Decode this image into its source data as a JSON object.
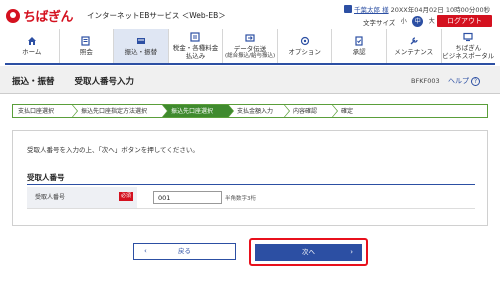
{
  "header": {
    "logo_text": "ちばぎん",
    "service_name": "インターネットEBサービス ＜Web-EB＞",
    "user_name": "千葉太郎 様",
    "login_time": "20XX年04月02日 10時00分00秒",
    "font_size_label": "文字サイズ",
    "font_sizes": [
      "小",
      "中",
      "大"
    ],
    "logout_label": "ログアウト"
  },
  "nav": {
    "items": [
      {
        "label": "ホーム",
        "icon": "home-icon"
      },
      {
        "label": "照会",
        "icon": "inquiry-icon"
      },
      {
        "label": "振込・振替",
        "icon": "transfer-icon"
      },
      {
        "label1": "税金・各種料金",
        "label2": "払込み",
        "icon": "tax-payment-icon"
      },
      {
        "label1": "データ伝送",
        "label2": "(総合振込/給与振込)",
        "icon": "data-transmission-icon"
      },
      {
        "label": "オプション",
        "icon": "option-icon"
      },
      {
        "label": "承認",
        "icon": "approval-icon"
      },
      {
        "label": "メンテナンス",
        "icon": "maintenance-icon"
      },
      {
        "label1": "ちばぎん",
        "label2": "ビジネスポータル",
        "icon": "portal-icon"
      }
    ]
  },
  "title_bar": {
    "category": "振込・振替",
    "title": "受取人番号入力",
    "screen_id": "BFKF003",
    "help_label": "ヘルプ"
  },
  "steps": [
    "支払口座選択",
    "振込先口座指定方法選択",
    "振込先口座選択",
    "支払金額入力",
    "内容確認",
    "確定"
  ],
  "main": {
    "instruction": "受取人番号を入力の上、「次へ」ボタンを押してください。",
    "section_title": "受取人番号",
    "field_label": "受取人番号",
    "required_label": "必須",
    "field_value": "001",
    "field_hint": "半角数字3桁"
  },
  "buttons": {
    "back_label": "戻る",
    "next_label": "次へ"
  },
  "colors": {
    "brand_red": "#d4111f",
    "accent_blue": "#2c4fa3",
    "step_green": "#3f8a2e"
  }
}
